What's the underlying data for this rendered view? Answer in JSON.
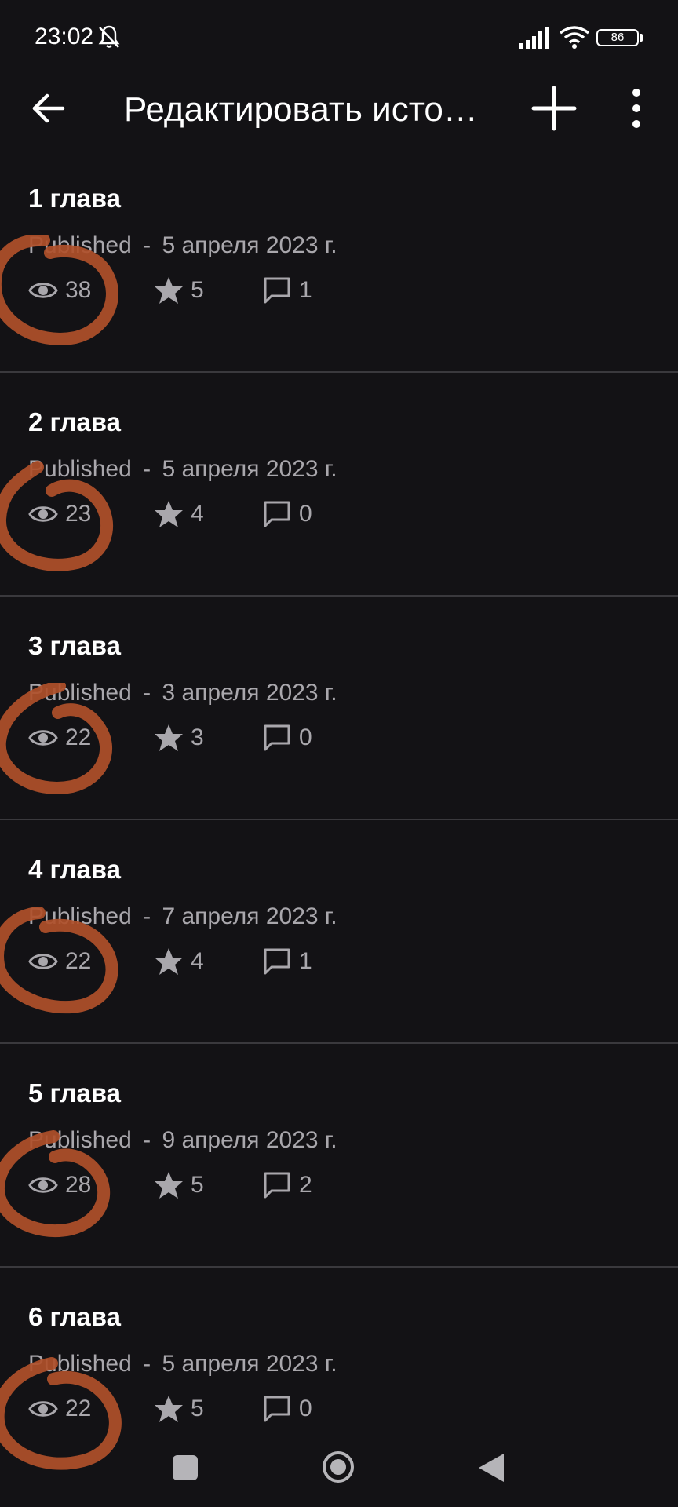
{
  "status_bar": {
    "time": "23:02",
    "battery": "86",
    "icons": [
      "bell-off-icon",
      "signal-icon",
      "wifi-icon",
      "battery-icon"
    ]
  },
  "app_bar": {
    "title": "Редактировать история",
    "icons": [
      "arrow-back-icon",
      "plus-icon",
      "more-vertical-icon"
    ]
  },
  "chapters": [
    {
      "title": "1 глава",
      "status": "Published",
      "separator": "-",
      "date": "5 апреля 2023 г.",
      "views": "38",
      "votes": "5",
      "comments": "1"
    },
    {
      "title": "2 глава",
      "status": "Published",
      "separator": "-",
      "date": "5 апреля 2023 г.",
      "views": "23",
      "votes": "4",
      "comments": "0"
    },
    {
      "title": "3 глава",
      "status": "Published",
      "separator": "-",
      "date": "3 апреля 2023 г.",
      "views": "22",
      "votes": "3",
      "comments": "0"
    },
    {
      "title": "4 глава",
      "status": "Published",
      "separator": "-",
      "date": "7 апреля 2023 г.",
      "views": "22",
      "votes": "4",
      "comments": "1"
    },
    {
      "title": "5 глава",
      "status": "Published",
      "separator": "-",
      "date": "9 апреля 2023 г.",
      "views": "28",
      "votes": "5",
      "comments": "2"
    },
    {
      "title": "6 глава",
      "status": "Published",
      "separator": "-",
      "date": "5 апреля 2023 г.",
      "views": "22",
      "votes": "5",
      "comments": "0"
    }
  ],
  "annotation": {
    "color": "#b0502a",
    "shape": "hand-drawn-circle-around-view-count"
  },
  "colors": {
    "background": "#131215",
    "text_primary": "#ffffff",
    "text_secondary": "#a9a7ac",
    "divider": "#3a393d"
  },
  "nav_bar": {
    "icons": [
      "recents-square-icon",
      "home-circle-icon",
      "back-triangle-icon"
    ]
  }
}
